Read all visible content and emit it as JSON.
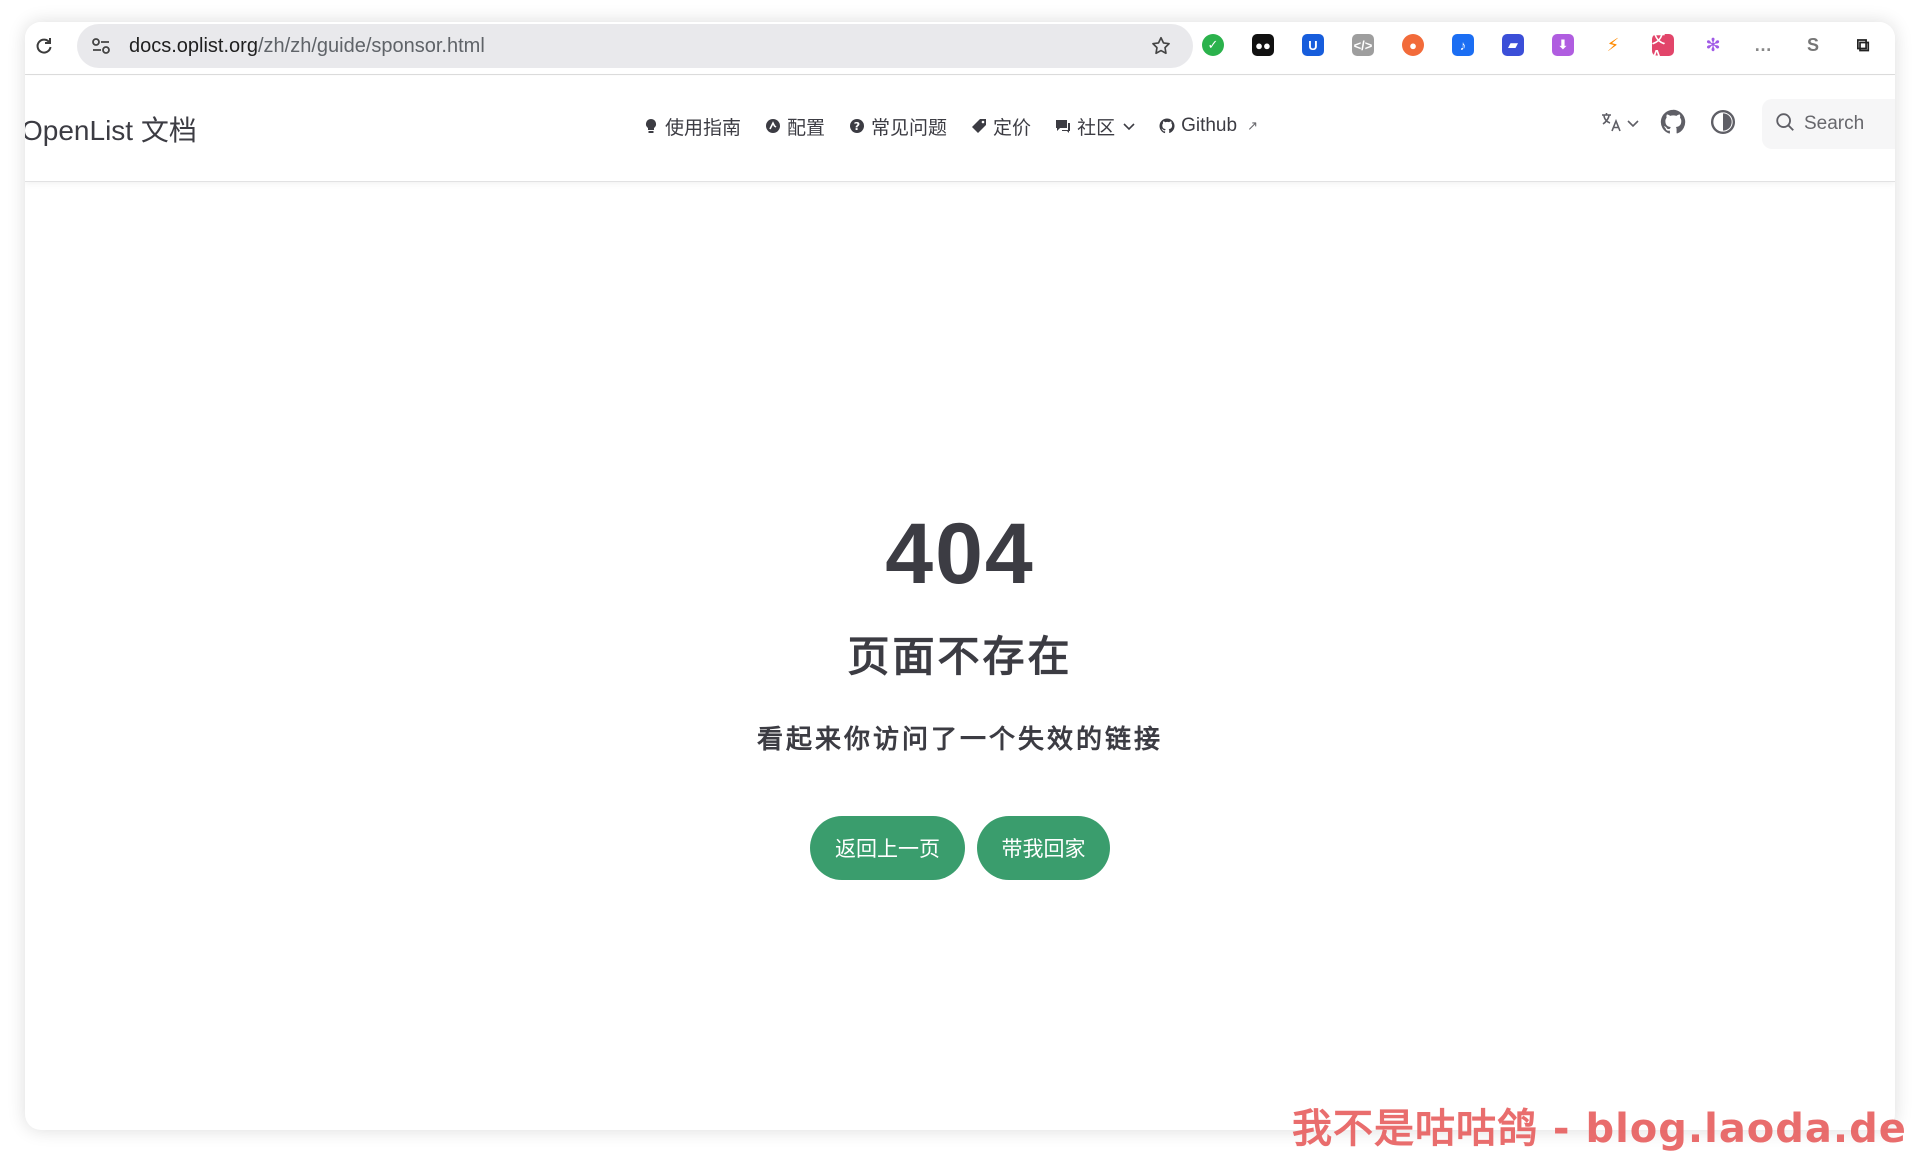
{
  "browser": {
    "url_host": "docs.oplist.org",
    "url_path": "/zh/zh/guide/sponsor.html",
    "extensions": [
      {
        "name": "ext-green-check-icon",
        "color": "#2bb24c",
        "glyph": "✓",
        "shape": "round"
      },
      {
        "name": "ext-glasses-icon",
        "color": "#111111",
        "glyph": "●●",
        "shape": "square"
      },
      {
        "name": "ext-bitwarden-icon",
        "color": "#175ddc",
        "glyph": "U",
        "shape": "square"
      },
      {
        "name": "ext-code-icon",
        "color": "#9e9e9e",
        "glyph": "</>",
        "shape": "square"
      },
      {
        "name": "ext-orange-blob-icon",
        "color": "#f26b3a",
        "glyph": "●",
        "shape": "round"
      },
      {
        "name": "ext-tiktok-icon",
        "color": "#1b6ef3",
        "glyph": "♪",
        "shape": "square"
      },
      {
        "name": "ext-blue-feather-icon",
        "color": "#3b4fd8",
        "glyph": "▰",
        "shape": "square"
      },
      {
        "name": "ext-purple-download-icon",
        "color": "#b05de0",
        "glyph": "⬇",
        "shape": "square"
      },
      {
        "name": "ext-lightning-icon",
        "color": "#ff8a00",
        "glyph": "⚡",
        "shape": "plain"
      },
      {
        "name": "ext-translate-icon",
        "color": "#e2456a",
        "glyph": "文A",
        "shape": "square"
      },
      {
        "name": "ext-openai-icon",
        "color": "#a05ae6",
        "glyph": "✻",
        "shape": "plain"
      },
      {
        "name": "ext-chat-bubble-icon",
        "color": "#888888",
        "glyph": "…",
        "shape": "plain"
      },
      {
        "name": "ext-s-icon",
        "color": "#777777",
        "glyph": "S",
        "shape": "plain"
      },
      {
        "name": "extensions-puzzle-icon",
        "color": "#222222",
        "glyph": "⧉",
        "shape": "plain"
      }
    ]
  },
  "nav": {
    "brand": "OpenList 文档",
    "items": [
      {
        "label": "使用指南",
        "icon": "lightbulb-icon"
      },
      {
        "label": "配置",
        "icon": "gear-icon"
      },
      {
        "label": "常见问题",
        "icon": "question-circle-icon"
      },
      {
        "label": "定价",
        "icon": "tag-icon"
      },
      {
        "label": "社区",
        "icon": "chat-icon"
      },
      {
        "label": "Github",
        "icon": "github-icon"
      }
    ],
    "search_label": "Search"
  },
  "not_found": {
    "code": "404",
    "title": "页面不存在",
    "quote": "看起来你访问了一个失效的链接",
    "back_label": "返回上一页",
    "home_label": "带我回家"
  },
  "watermark": "我不是咕咕鸽 - blog.laoda.de",
  "colors": {
    "accent": "#3a9d6d",
    "text": "#3c3c43"
  }
}
